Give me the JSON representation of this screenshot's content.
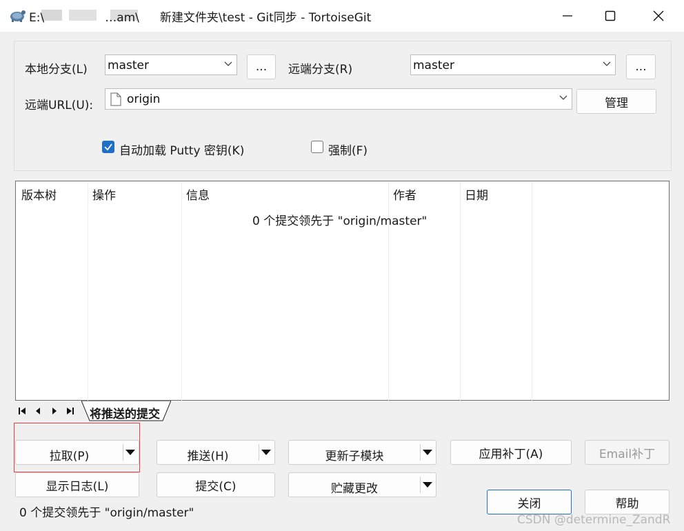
{
  "window": {
    "title_prefix": "E:\\",
    "title_mid": "…am\\",
    "title_suffix": "新建文件夹\\test - Git同步 - TortoiseGit",
    "minimize_icon": "minimize-icon",
    "maximize_icon": "maximize-icon",
    "close_icon": "close-icon"
  },
  "branches": {
    "local_label": "本地分支(L)",
    "local_value": "master",
    "local_browse": "...",
    "remote_label": "远端分支(R)",
    "remote_value": "master",
    "remote_browse": "...",
    "url_label": "远端URL(U):",
    "url_value": "origin",
    "manage_label": "管理"
  },
  "options": {
    "autoload_putty": {
      "label": "自动加载 Putty 密钥(K)",
      "checked": true
    },
    "force": {
      "label": "强制(F)",
      "checked": false
    }
  },
  "commits_list": {
    "columns": [
      "版本树",
      "操作",
      "信息",
      "作者",
      "日期"
    ],
    "empty_message": "0 个提交领先于 \"origin/master\""
  },
  "tabs": {
    "active_label": "将推送的提交",
    "nav": [
      "⏮",
      "◀",
      "▶",
      "⏭"
    ]
  },
  "actions": {
    "pull": "拉取(P)",
    "push": "推送(H)",
    "update_submodules": "更新子模块",
    "apply_patch": "应用补丁(A)",
    "email_patch": "Email补丁",
    "show_log": "显示日志(L)",
    "commit": "提交(C)",
    "stash": "贮藏更改",
    "close": "关闭",
    "help": "帮助"
  },
  "status": {
    "text": "0 个提交领先于 \"origin/master\""
  },
  "watermark": "CSDN @determine_ZandR",
  "colors": {
    "accent": "#1f6fc5",
    "highlight_box": "#e04040"
  }
}
